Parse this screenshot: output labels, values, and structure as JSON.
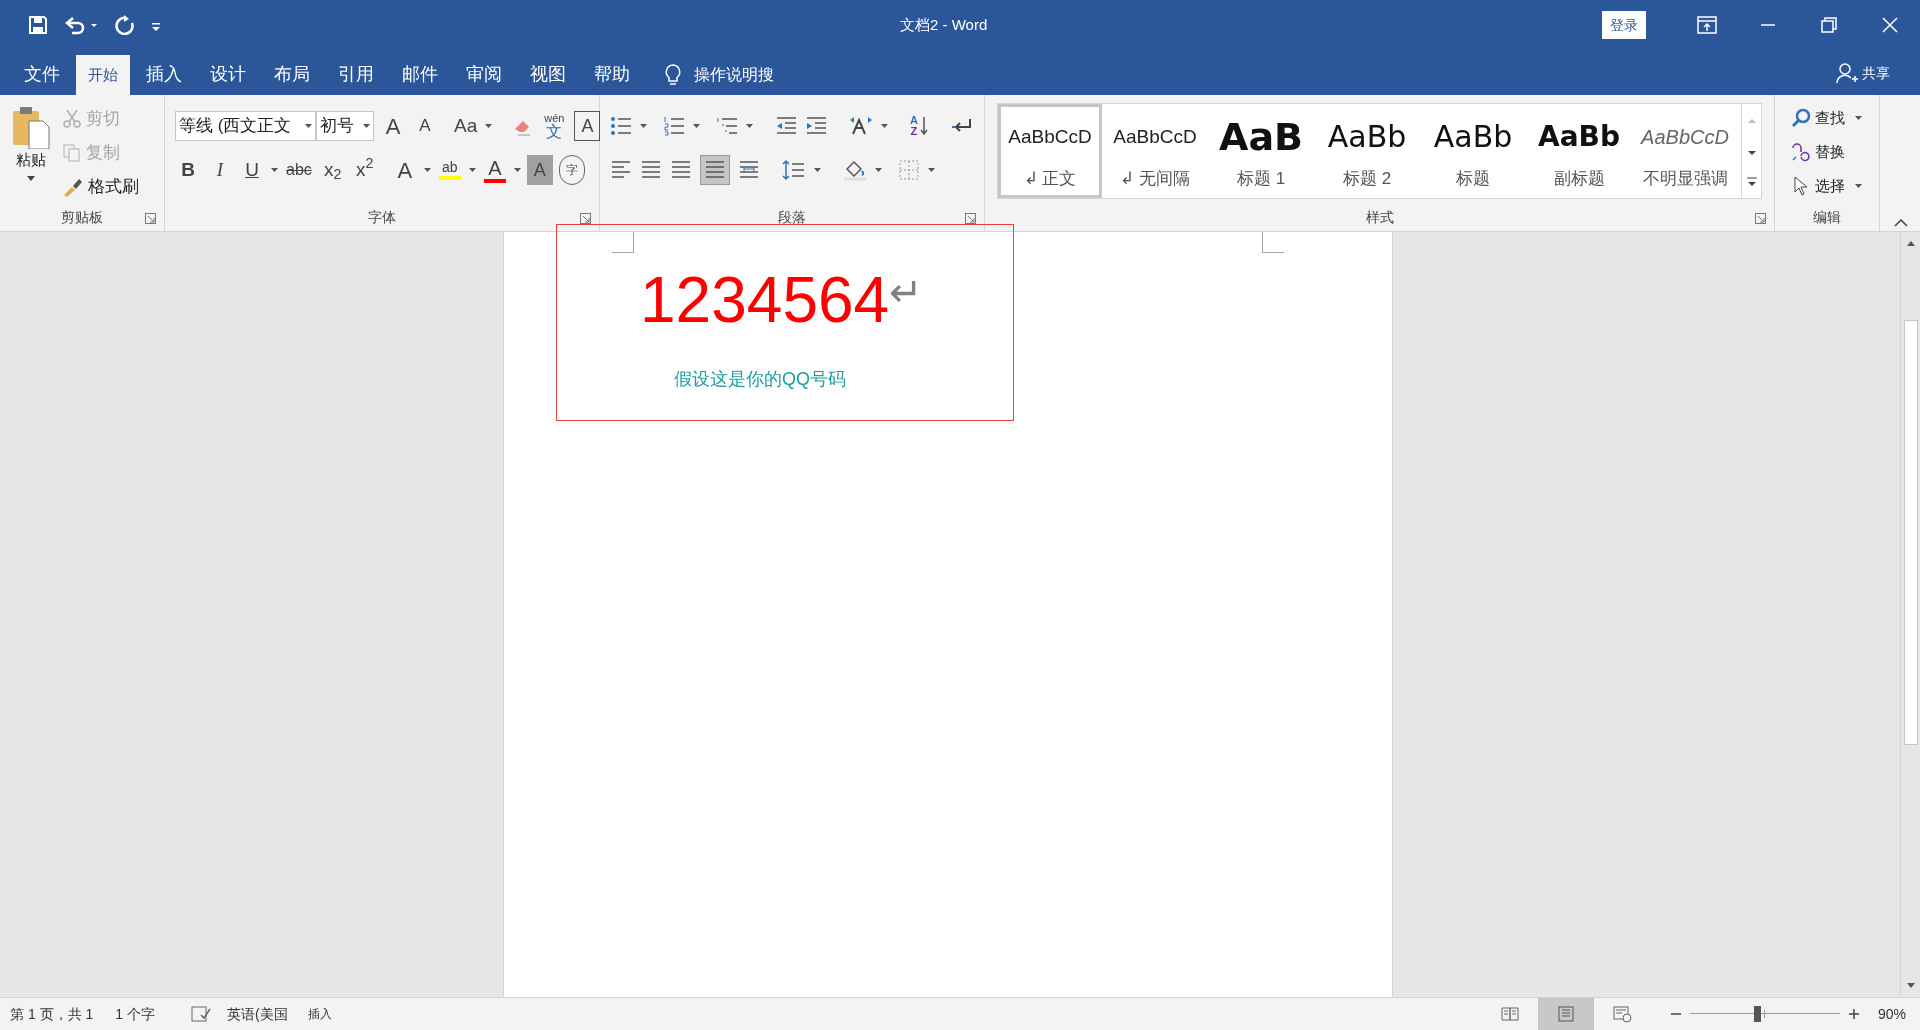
{
  "window": {
    "title": "文档2  -  Word",
    "sign_in": "登录"
  },
  "tabs": [
    {
      "label": "文件",
      "selected": false
    },
    {
      "label": "开始",
      "selected": true
    },
    {
      "label": "插入",
      "selected": false
    },
    {
      "label": "设计",
      "selected": false
    },
    {
      "label": "布局",
      "selected": false
    },
    {
      "label": "引用",
      "selected": false
    },
    {
      "label": "邮件",
      "selected": false
    },
    {
      "label": "审阅",
      "selected": false
    },
    {
      "label": "视图",
      "selected": false
    },
    {
      "label": "帮助",
      "selected": false
    }
  ],
  "tell_me": "操作说明搜",
  "share": "共享",
  "clipboard": {
    "label": "剪贴板",
    "paste": "粘贴",
    "cut": {
      "label": "剪切",
      "disabled": true
    },
    "copy": {
      "label": "复制",
      "disabled": true
    },
    "format_painter": {
      "label": "格式刷",
      "disabled": false
    }
  },
  "font": {
    "label": "字体",
    "font_name": "等线 (西文正文",
    "font_size": "初号",
    "grow": "A",
    "shrink": "A",
    "change_case": "Aa",
    "phonetic_top": "wén",
    "phonetic_bottom": "文",
    "border_char": "A",
    "bold": "B",
    "italic": "I",
    "underline": "U",
    "strike": "abc",
    "subscript": "x$_{2}$",
    "superscript": "x$^{2}$",
    "effects": "A",
    "highlight": "ab",
    "font_color": "A",
    "shading": "A",
    "enclose": "字"
  },
  "paragraph": {
    "label": "段落",
    "sort_top": "A",
    "sort_bottom": "Z",
    "justify_selected": true
  },
  "styles": {
    "label": "样式",
    "items": [
      {
        "preview": "AaBbCcD",
        "name": "↲ 正文",
        "kind": "normal",
        "selected": true
      },
      {
        "preview": "AaBbCcD",
        "name": "↲ 无间隔",
        "kind": "normal",
        "selected": false
      },
      {
        "preview": "AaB",
        "name": "标题 1",
        "kind": "heading1",
        "selected": false
      },
      {
        "preview": "AaBb",
        "name": "标题 2",
        "kind": "heading2",
        "selected": false
      },
      {
        "preview": "AaBb",
        "name": "标题",
        "kind": "title",
        "selected": false
      },
      {
        "preview": "AaBb",
        "name": "副标题",
        "kind": "subtitle",
        "selected": false
      },
      {
        "preview": "AaBbCcD",
        "name": "不明显强调",
        "kind": "emphasis",
        "selected": false
      }
    ]
  },
  "editing": {
    "label": "编辑",
    "find": "查找",
    "replace": "替换",
    "select": "选择"
  },
  "document": {
    "number": "1234564",
    "paragraph_mark": "↵",
    "caption": "假设这是你的QQ号码"
  },
  "status_bar": {
    "page": "第 1 页，共 1",
    "words": "1 个字",
    "language": "英语(美国",
    "mode": "插入",
    "views": [
      {
        "selected": false
      },
      {
        "selected": true
      },
      {
        "selected": false
      }
    ],
    "zoom": {
      "level": 0.45,
      "reading": "90%"
    }
  }
}
